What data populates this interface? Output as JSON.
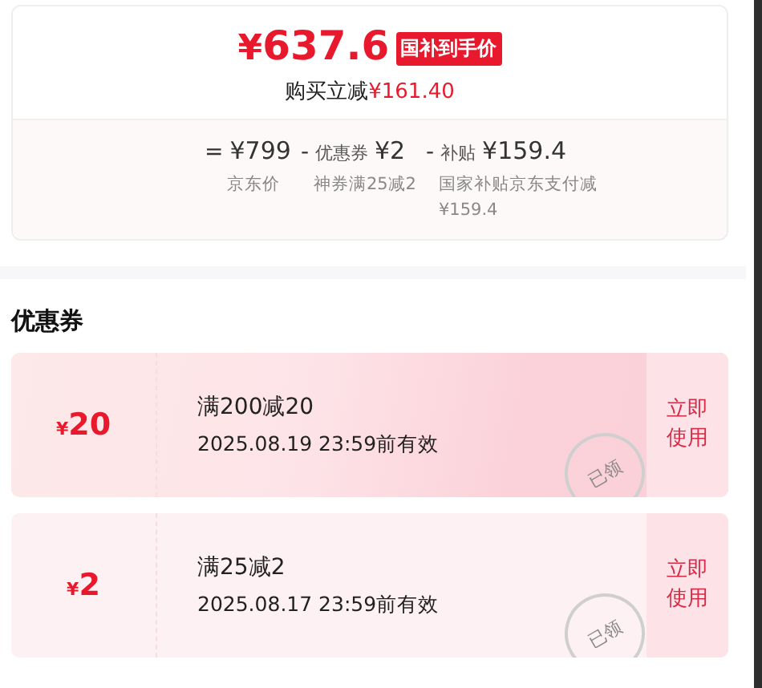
{
  "price_card": {
    "currency": "¥",
    "price": "637.6",
    "badge": "国补到手价",
    "savings_label": "购买立减",
    "savings_value": "¥161.40",
    "breakdown": [
      {
        "sign": "=",
        "value": "¥799",
        "note": "京东价"
      },
      {
        "sign": "-",
        "label": "优惠券",
        "value": "¥2",
        "note": "神券满25减2"
      },
      {
        "sign": "-",
        "label": "补贴",
        "value": "¥159.4",
        "note": "国家补贴京东支付减¥159.4"
      }
    ]
  },
  "coupons_section": {
    "title": "优惠券",
    "coupons": [
      {
        "kind": "featured",
        "currency": "¥",
        "amount": "20",
        "condition": "满200减20",
        "validity": "2025.08.19 23:59前有效",
        "claimed": true,
        "stamp": "已领",
        "action": "立即使用"
      },
      {
        "kind": "plain",
        "currency": "¥",
        "amount": "2",
        "condition": "满25减2",
        "validity": "2025.08.17 23:59前有效",
        "claimed": true,
        "stamp": "已领",
        "action": "立即使用"
      }
    ]
  }
}
